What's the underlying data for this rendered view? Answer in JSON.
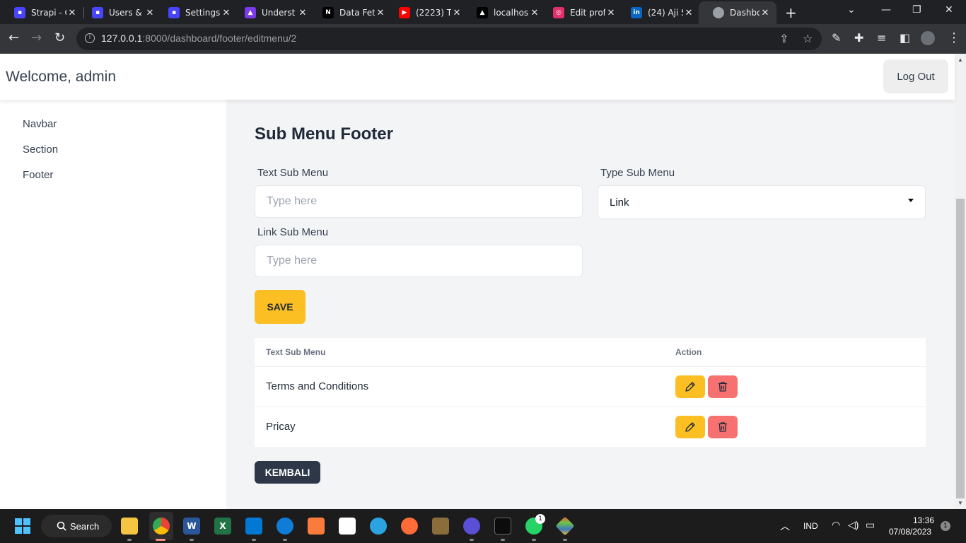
{
  "browser": {
    "tabs": [
      {
        "title": "Strapi - C",
        "icon": "strapi-icon",
        "color": "#4945ff"
      },
      {
        "title": "Users &",
        "icon": "strapi-icon",
        "color": "#4945ff"
      },
      {
        "title": "Settings",
        "icon": "strapi-icon",
        "color": "#4945ff"
      },
      {
        "title": "Underst",
        "icon": "docs-icon",
        "color": "#7c3aed"
      },
      {
        "title": "Data Fet",
        "icon": "nextjs-icon",
        "color": "#000000"
      },
      {
        "title": "(2223) T",
        "icon": "youtube-icon",
        "color": "#ff0000"
      },
      {
        "title": "localhos",
        "icon": "vercel-icon",
        "color": "#000000"
      },
      {
        "title": "Edit prof",
        "icon": "instagram-icon",
        "color": "#e1306c"
      },
      {
        "title": "(24) Aji S",
        "icon": "linkedin-icon",
        "color": "#0a66c2"
      },
      {
        "title": "Dashbo",
        "icon": "globe-icon",
        "color": "#9aa0a6"
      }
    ],
    "url_host": "127.0.0.1",
    "url_rest": ":8000/dashboard/footer/editmenu/2"
  },
  "header": {
    "welcome": "Welcome, admin",
    "logout_label": "Log Out"
  },
  "sidebar": {
    "items": [
      {
        "label": "Navbar"
      },
      {
        "label": "Section"
      },
      {
        "label": "Footer"
      }
    ]
  },
  "main": {
    "title": "Sub Menu Footer",
    "form": {
      "text_label": "Text Sub Menu",
      "text_placeholder": "Type here",
      "type_label": "Type Sub Menu",
      "type_value": "Link",
      "link_label": "Link Sub Menu",
      "link_placeholder": "Type here",
      "save_label": "SAVE"
    },
    "table": {
      "headers": [
        "Text Sub Menu",
        "Action"
      ],
      "rows": [
        {
          "text": "Terms and Conditions"
        },
        {
          "text": "Pricay"
        }
      ]
    },
    "back_label": "KEMBALI"
  },
  "taskbar": {
    "search_label": "Search",
    "language": "IND",
    "time": "13:36",
    "date": "07/08/2023",
    "whatsapp_badge": "1",
    "notification_badge": "1"
  },
  "colors": {
    "accent_yellow": "#fbbf24",
    "danger_red": "#f87171",
    "dark_button": "#2d3748"
  }
}
